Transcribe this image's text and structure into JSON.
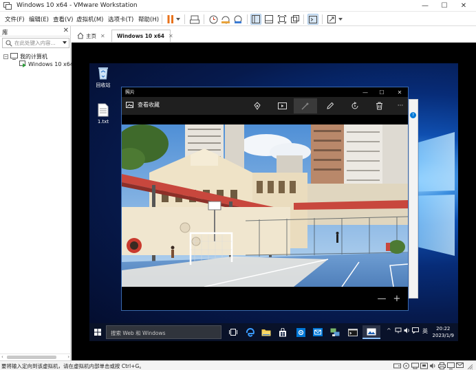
{
  "window": {
    "title": "Windows 10 x64 - VMware Workstation",
    "minimize": "—",
    "maximize": "☐",
    "close": "✕"
  },
  "menu": {
    "items": [
      "文件(F)",
      "编辑(E)",
      "查看(V)",
      "虚拟机(M)",
      "选项卡(T)",
      "帮助(H)"
    ]
  },
  "sidebar": {
    "title": "库",
    "close": "✕",
    "search_placeholder": "在此处键入内容...",
    "tree": {
      "root": "我的计算机",
      "vm": "Windows 10 x64"
    }
  },
  "tabs": [
    {
      "label": "主页"
    },
    {
      "label": "Windows 10 x64"
    }
  ],
  "guest": {
    "desktop_icons": [
      {
        "label": "回收站"
      },
      {
        "label": "1.txt"
      }
    ],
    "photos": {
      "app_name": "照片",
      "view_collection": "查看收藏",
      "more": "···",
      "zoom_out": "—",
      "zoom_in": "+"
    },
    "taskbar": {
      "search_label": "搜索 Web 和 Windows",
      "ime": "英",
      "time": "20:22",
      "date": "2023/1/9"
    }
  },
  "status": {
    "text": "要将输入定向到该虚拟机，请在虚拟机内部单击或按 Ctrl+G。"
  },
  "colors": {
    "accent": "#0078d7",
    "pause_orange": "#e8731c",
    "desktop_blue": "#0f4fb0"
  }
}
